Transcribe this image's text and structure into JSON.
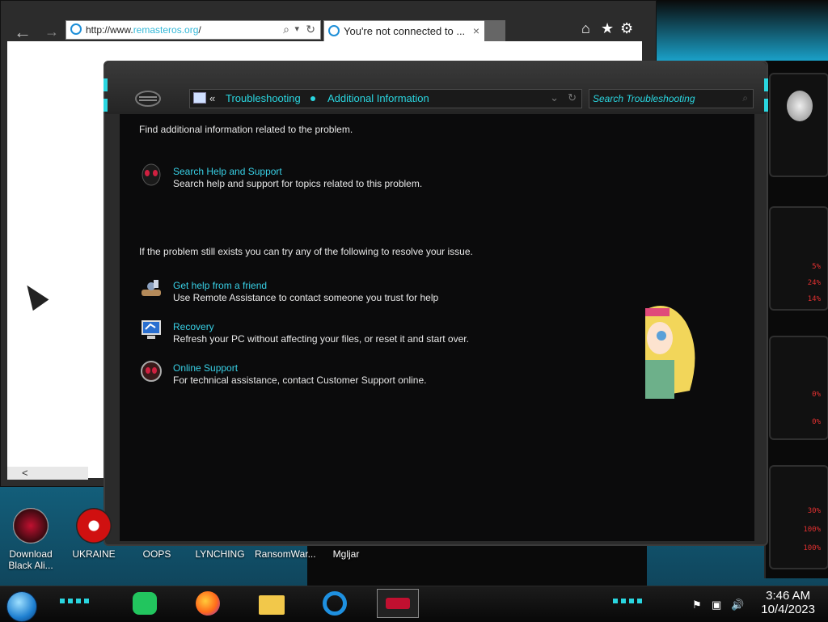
{
  "browser": {
    "address": {
      "prefix": "http://www.",
      "domain": "remasteros.org",
      "suffix": "/"
    },
    "tab_title": "You're not connected to ...",
    "tab_close": "×",
    "nav": {
      "back": "←",
      "forward": "→",
      "search": "⌕",
      "dropdown": "▾",
      "refresh": "↻"
    },
    "toolbar": {
      "home": "⌂",
      "favorites": "★",
      "settings": "⚙"
    },
    "scroll_left": "<"
  },
  "troubleshooting": {
    "breadcrumb": {
      "back_chevron": "«",
      "items": [
        "Troubleshooting",
        "Additional Information"
      ]
    },
    "search_placeholder": "Search Troubleshooting",
    "intro": "Find additional information related to the problem.",
    "help_section": {
      "title": "Search Help and Support",
      "description": "Search help and support for topics related to this problem."
    },
    "resolve_intro": "If the problem still exists you can try any of the following to resolve your issue.",
    "options": [
      {
        "title": "Get help from a friend",
        "description": "Use Remote Assistance to contact someone you trust for help",
        "icon": "remote-assistance-icon"
      },
      {
        "title": "Recovery",
        "description": "Refresh your PC without affecting your files, or reset it and start over.",
        "icon": "recovery-icon"
      },
      {
        "title": "Online Support",
        "description": "For technical assistance, contact Customer Support online.",
        "icon": "online-support-icon"
      }
    ]
  },
  "desktop_icons": [
    {
      "label": "Download Black Ali...",
      "icon": "alien-orb-icon"
    },
    {
      "label": "UKRAINE",
      "icon": "radiation-icon"
    },
    {
      "label": "OOPS",
      "icon": "blank-icon"
    },
    {
      "label": "LYNCHING",
      "icon": "blank-icon"
    },
    {
      "label": "RansomWar...",
      "icon": "blank-icon"
    },
    {
      "label": "Mgljar",
      "icon": "blank-icon"
    }
  ],
  "hud": {
    "readings": [
      "5%",
      "24%",
      "14%",
      "0%",
      "0%",
      "30%",
      "100%",
      "100%"
    ]
  },
  "taskbar": {
    "clock": {
      "time": "3:46 AM",
      "date": "10/4/2023"
    },
    "apps": [
      "chat-app-icon",
      "firefox-icon",
      "file-explorer-icon",
      "internet-explorer-icon",
      "alien-app-icon"
    ],
    "tray": {
      "flag": "⚑",
      "network": "▣",
      "volume": "🔊"
    }
  },
  "colors": {
    "accent": "#2ad6e0",
    "link": "#38d0e6",
    "window_body": "#0b0b0c",
    "hud_text": "#e03030"
  }
}
